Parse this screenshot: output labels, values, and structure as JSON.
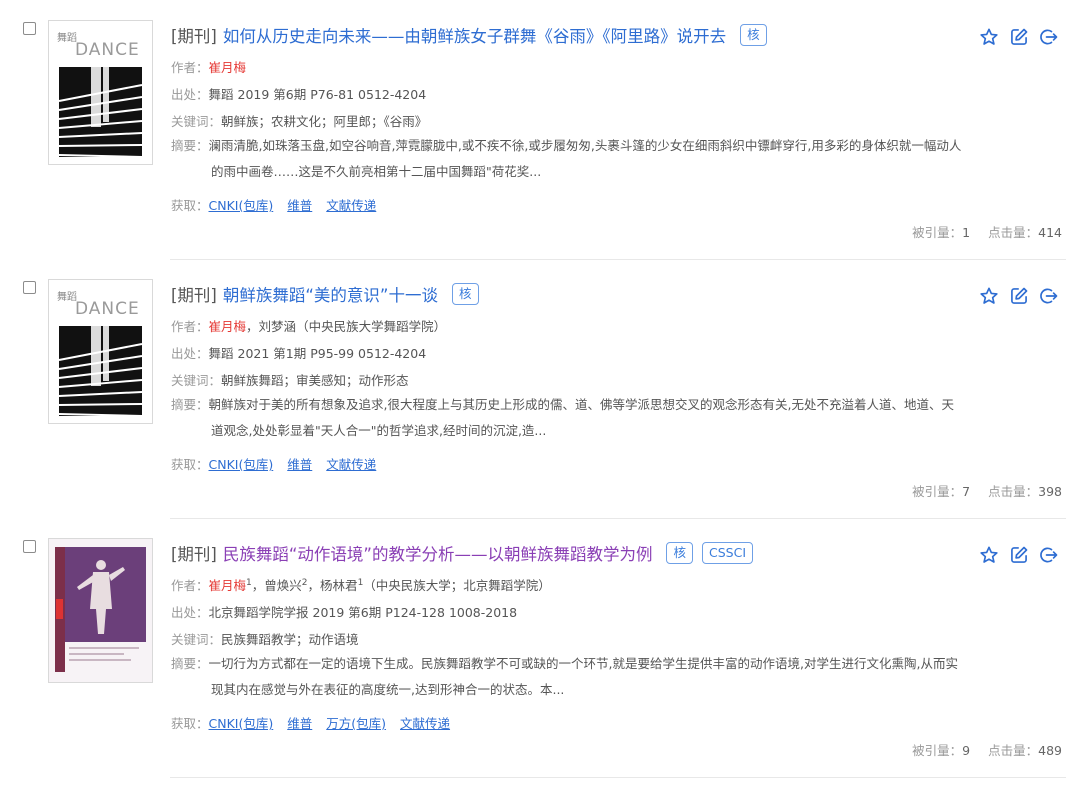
{
  "results": [
    {
      "type": "[期刊]",
      "title": "如何从历史走向未来——由朝鲜族女子群舞《谷雨》《阿里路》说开去",
      "tags": [
        "核"
      ],
      "author_label": "作者：",
      "authors_html_parts": [
        {
          "name": "崔月梅",
          "highlight": true,
          "sup": ""
        }
      ],
      "affiliation": "",
      "source_label": "出处：",
      "source": "舞蹈 2019 第6期 P76-81  0512-4204",
      "keywords_label": "关键词：",
      "keywords": "朝鲜族；农耕文化；阿里郎；《谷雨》",
      "abstract_label": "摘要：",
      "abstract_line1": "澜雨清脆,如珠落玉盘,如空谷响音,萍霓朦胧中,或不疾不徐,或步履匆匆,头裹斗篷的少女在细雨斜织中镖衅穿行,用多彩的身体织就一幅动人",
      "abstract_line2": "的雨中画卷……这是不久前亮相第十二届中国舞蹈\"荷花奖...",
      "access_label": "获取：",
      "access_links": [
        "CNKI(包库)",
        "维普",
        "文献传递"
      ],
      "cited_label": "被引量：",
      "cited": "1",
      "clicks_label": "点击量：",
      "clicks": "414",
      "cover": "dance-magazine"
    },
    {
      "type": "[期刊]",
      "title": "朝鲜族舞蹈“美的意识”十一谈",
      "tags": [
        "核"
      ],
      "author_label": "作者：",
      "authors_html_parts": [
        {
          "name": "崔月梅",
          "highlight": true,
          "sup": ""
        },
        {
          "name": "刘梦涵",
          "highlight": false,
          "sup": ""
        }
      ],
      "affiliation": "（中央民族大学舞蹈学院）",
      "source_label": "出处：",
      "source": "舞蹈 2021 第1期 P95-99  0512-4204",
      "keywords_label": "关键词：",
      "keywords": "朝鲜族舞蹈；审美感知；动作形态",
      "abstract_label": "摘要：",
      "abstract_line1": "朝鲜族对于美的所有想象及追求,很大程度上与其历史上形成的儒、道、佛等学派思想交叉的观念形态有关,无处不充溢着人道、地道、天",
      "abstract_line2": "道观念,处处彰显着\"天人合一\"的哲学追求,经时间的沉淀,造...",
      "access_label": "获取：",
      "access_links": [
        "CNKI(包库)",
        "维普",
        "文献传递"
      ],
      "cited_label": "被引量：",
      "cited": "7",
      "clicks_label": "点击量：",
      "clicks": "398",
      "cover": "dance-magazine"
    },
    {
      "type": "[期刊]",
      "title": "民族舞蹈“动作语境”的教学分析——以朝鲜族舞蹈教学为例",
      "tags": [
        "核",
        "CSSCI"
      ],
      "author_label": "作者：",
      "authors_html_parts": [
        {
          "name": "崔月梅",
          "highlight": true,
          "sup": "1"
        },
        {
          "name": "曾焕兴",
          "highlight": false,
          "sup": "2"
        },
        {
          "name": "杨林君",
          "highlight": false,
          "sup": "1"
        }
      ],
      "affiliation": "（中央民族大学；北京舞蹈学院）",
      "source_label": "出处：",
      "source": "北京舞蹈学院学报 2019 第6期 P124-128  1008-2018",
      "keywords_label": "关键词：",
      "keywords": "民族舞蹈教学；动作语境",
      "abstract_label": "摘要：",
      "abstract_line1": "一切行为方式都在一定的语境下生成。民族舞蹈教学不可或缺的一个环节,就是要给学生提供丰富的动作语境,对学生进行文化熏陶,从而实",
      "abstract_line2": "现其内在感觉与外在表征的高度统一,达到形神合一的状态。本...",
      "access_label": "获取：",
      "access_links": [
        "CNKI(包库)",
        "维普",
        "万方(包库)",
        "文献传递"
      ],
      "cited_label": "被引量：",
      "cited": "9",
      "clicks_label": "点击量：",
      "clicks": "489",
      "cover": "bfa-journal"
    }
  ],
  "cover_text": {
    "dance_logo": "DANCE",
    "dance_cn": "舞蹈"
  },
  "colors": {
    "link": "#2e6dd2",
    "visited": "#8a3fb5",
    "author_highlight": "#e53935",
    "tag_border": "#6fa0e6"
  },
  "icons": [
    "star-icon",
    "edit-icon",
    "share-exit-icon"
  ]
}
